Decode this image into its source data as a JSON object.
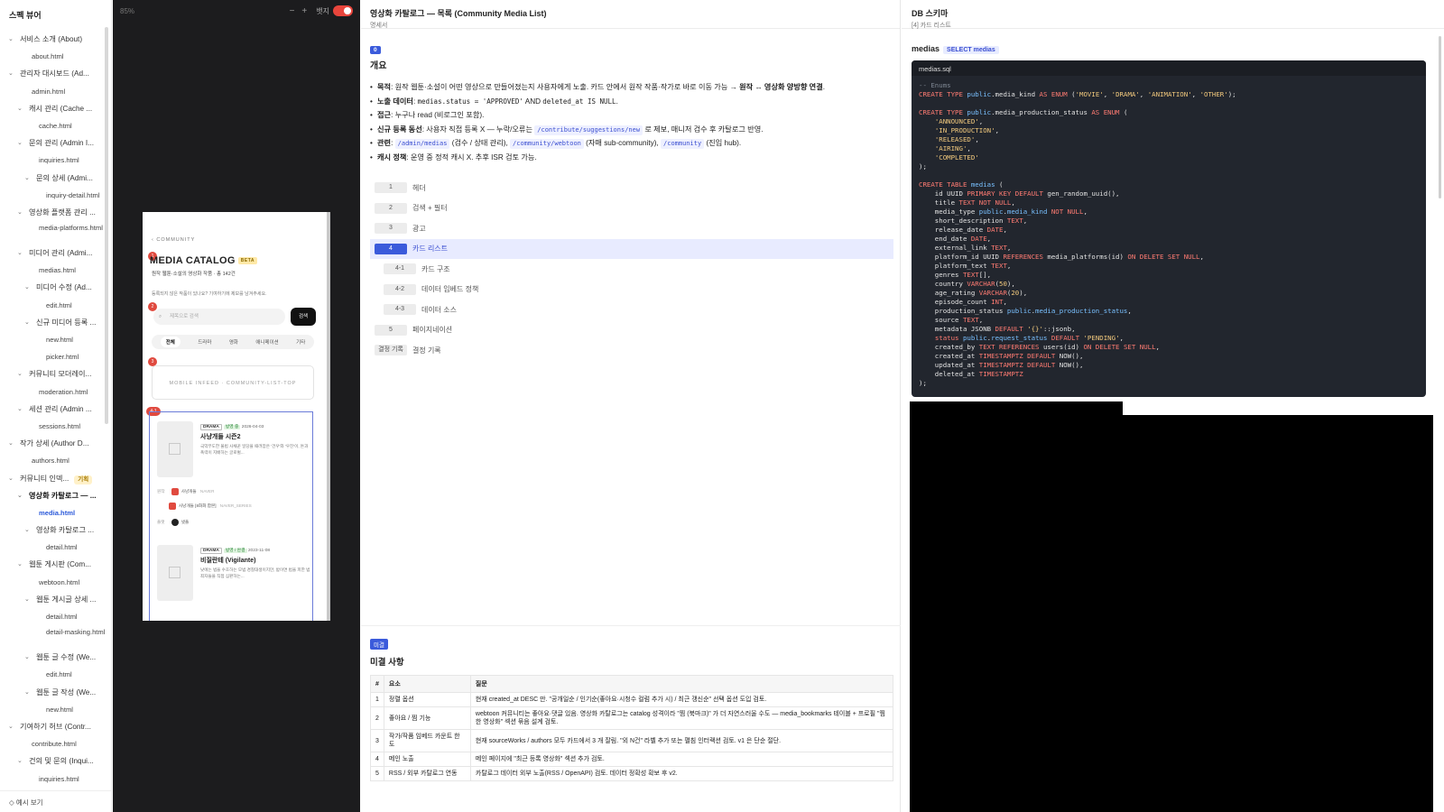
{
  "sidebar": {
    "title": "스펙 뷰어",
    "items": [
      {
        "label": "서비스 소개 (About)",
        "depth": 0,
        "type": "folder"
      },
      {
        "label": "about.html",
        "depth": 1,
        "type": "file"
      },
      {
        "label": "관리자 대시보드 (Ad...",
        "depth": 0,
        "type": "folder"
      },
      {
        "label": "admin.html",
        "depth": 1,
        "type": "file"
      },
      {
        "label": "캐시 관리 (Cache ...",
        "depth": 1,
        "type": "folder"
      },
      {
        "label": "cache.html",
        "depth": 2,
        "type": "file"
      },
      {
        "label": "문의 관리 (Admin I...",
        "depth": 1,
        "type": "folder"
      },
      {
        "label": "inquiries.html",
        "depth": 2,
        "type": "file"
      },
      {
        "label": "문의 상세 (Admi...",
        "depth": 2,
        "type": "folder"
      },
      {
        "label": "inquiry-detail.html",
        "depth": 3,
        "type": "file"
      },
      {
        "label": "영상화 플랫폼 관리 ...",
        "depth": 1,
        "type": "folder"
      },
      {
        "label": "media-platforms.html",
        "depth": 2,
        "type": "file",
        "two": true
      },
      {
        "label": "미디어 관리 (Admi...",
        "depth": 1,
        "type": "folder"
      },
      {
        "label": "medias.html",
        "depth": 2,
        "type": "file"
      },
      {
        "label": "미디어 수정 (Ad...",
        "depth": 2,
        "type": "folder"
      },
      {
        "label": "edit.html",
        "depth": 3,
        "type": "file"
      },
      {
        "label": "신규 미디어 등록 ...",
        "depth": 2,
        "type": "folder"
      },
      {
        "label": "new.html",
        "depth": 3,
        "type": "file"
      },
      {
        "label": "picker.html",
        "depth": 3,
        "type": "file"
      },
      {
        "label": "커뮤니티 모더레이...",
        "depth": 1,
        "type": "folder"
      },
      {
        "label": "moderation.html",
        "depth": 2,
        "type": "file"
      },
      {
        "label": "세션 관리 (Admin ...",
        "depth": 1,
        "type": "folder"
      },
      {
        "label": "sessions.html",
        "depth": 2,
        "type": "file"
      },
      {
        "label": "작가 상세 (Author D...",
        "depth": 0,
        "type": "folder"
      },
      {
        "label": "authors.html",
        "depth": 1,
        "type": "file"
      },
      {
        "label": "커뮤니티 인덱...",
        "depth": 0,
        "type": "folder",
        "badge": "기획"
      },
      {
        "label": "영상화 카탈로그 — ...",
        "depth": 1,
        "type": "folder",
        "bold": true
      },
      {
        "label": "media.html",
        "depth": 2,
        "type": "file",
        "active": true
      },
      {
        "label": "영상화 카탈로그 ...",
        "depth": 2,
        "type": "folder"
      },
      {
        "label": "detail.html",
        "depth": 3,
        "type": "file"
      },
      {
        "label": "웹툰 게시판 (Com...",
        "depth": 1,
        "type": "folder"
      },
      {
        "label": "webtoon.html",
        "depth": 2,
        "type": "file"
      },
      {
        "label": "웹툰 게시글 상세 ...",
        "depth": 2,
        "type": "folder"
      },
      {
        "label": "detail.html",
        "depth": 3,
        "type": "file"
      },
      {
        "label": "detail-masking.html",
        "depth": 3,
        "type": "file",
        "two": true
      },
      {
        "label": "웹툰 글 수정 (We...",
        "depth": 2,
        "type": "folder"
      },
      {
        "label": "edit.html",
        "depth": 3,
        "type": "file"
      },
      {
        "label": "웹툰 글 작성 (We...",
        "depth": 2,
        "type": "folder"
      },
      {
        "label": "new.html",
        "depth": 3,
        "type": "file"
      },
      {
        "label": "기여하기 허브 (Contr...",
        "depth": 0,
        "type": "folder"
      },
      {
        "label": "contribute.html",
        "depth": 1,
        "type": "file"
      },
      {
        "label": "건의 및 문의 (Inqui...",
        "depth": 1,
        "type": "folder"
      },
      {
        "label": "inquiries.html",
        "depth": 2,
        "type": "file"
      }
    ],
    "footer": "예시 보기"
  },
  "preview": {
    "zoom": "85%",
    "minus": "−",
    "plus": "+",
    "toggle_label": "뱃지",
    "phone": {
      "crumb": "‹ COMMUNITY",
      "title": "MEDIA CATALOG",
      "beta": "BETA",
      "sub": "원작 웹툰·소설의 영상화 작품 · 총 142건",
      "sub2": "등록되지 않은 작품이 있나요? 기여하기에 제보를 남겨주세요.",
      "search_placeholder": "제목으로 검색",
      "search_btn": "검색",
      "tabs": [
        "전체",
        "드라마",
        "영화",
        "애니메이션",
        "기타"
      ],
      "ad": "MOBILE INFEED · COMMUNITY-LIST-TOP",
      "pins": [
        "1",
        "2",
        "3",
        "4-1"
      ],
      "cards": [
        {
          "kind": "DRAMA",
          "status": "방영 중",
          "date": "2026-04-03",
          "title": "사냥개들 시즌2",
          "desc": "극악무도한 불법 사채꾼 일당을 때려잡은 '건우'와 '우진'이, 돈과 폭력이 지배하는 글로벌...",
          "row1": "원작",
          "src1": "사냥개들",
          "src1_tag": "NAVER",
          "src2": "사냥개들 [8화화 합본]",
          "src2_tag": "NAVER_SERIES",
          "row2": "플랫",
          "platform": "넷플"
        },
        {
          "kind": "DRAMA",
          "status": "방영 / 완결",
          "date": "2023-11-08",
          "title": "비질란테 (Vigilante)",
          "desc": "낮에는 법을 수호하는 모범 경찰대생이지만, 밤이면 법을 피한 범죄자들을 직접 심판하는..."
        }
      ]
    }
  },
  "doc": {
    "title": "영상화 카탈로그 — 목록 (Community Media List)",
    "subtitle": "명세서",
    "overview_badge": "0",
    "overview_title": "개요",
    "bullets": {
      "b1_label": "목적",
      "b1_text": ": 원작 웹툰·소설이 어떤 영상으로 만들어졌는지 사용자에게 노출. 카드 안에서 원작 작품·작가로 바로 이동 가능 → ",
      "b1_bold": "원작 ↔ 영상화 양방향 연결",
      "b1_end": ".",
      "b2_label": "노출 데이터",
      "b2_code1": "medias.status = 'APPROVED'",
      "b2_mid": " AND ",
      "b2_code2": "deleted_at IS NULL",
      "b2_end": ".",
      "b3_label": "접근",
      "b3_text": ": 누구나 read (비로그인 포함).",
      "b4_label": "신규 등록 동선",
      "b4_text": ": 사용자 직접 등록 X — 누락/오류는 ",
      "b4_link": "/contribute/suggestions/new",
      "b4_end": " 로 제보, 매니저 검수 후 카탈로그 반영.",
      "b5_label": "관련",
      "b5_link1": "/admin/medias",
      "b5_t1": " (검수 / 상태 관리), ",
      "b5_link2": "/community/webtoon",
      "b5_t2": " (자매 sub-community), ",
      "b5_link3": "/community",
      "b5_t3": " (진입 hub).",
      "b6_label": "캐시 정책",
      "b6_text": ": 운영 중 정적 캐시 X. 추후 ISR 검토 가능."
    },
    "toc": [
      {
        "num": "1",
        "label": "헤더",
        "sub": false
      },
      {
        "num": "2",
        "label": "검색 + 필터",
        "sub": false
      },
      {
        "num": "3",
        "label": "광고",
        "sub": false
      },
      {
        "num": "4",
        "label": "카드 리스트",
        "sub": false,
        "active": true
      },
      {
        "num": "4-1",
        "label": "카드 구조",
        "sub": true
      },
      {
        "num": "4-2",
        "label": "데이터 임베드 정책",
        "sub": true
      },
      {
        "num": "4-3",
        "label": "데이터 소스",
        "sub": true
      },
      {
        "num": "5",
        "label": "페이지네이션",
        "sub": false
      },
      {
        "num": "결정 기록",
        "label": "결정 기록",
        "sub": false
      }
    ],
    "unresolved": {
      "badge": "미결",
      "title": "미결 사항",
      "headers": [
        "#",
        "요소",
        "질문"
      ],
      "rows": [
        {
          "n": "1",
          "el": "정렬 옵션",
          "q": "현재 created_at DESC 만. \"공개일순 / 인기순(좋아요·시청수 컬럼 추가 시) / 최근 갱신순\" 선택 옵션 도입 검토."
        },
        {
          "n": "2",
          "el": "좋아요 / 찜 기능",
          "q": "webtoon 커뮤니티는 좋아요·댓글 있음. 영상화 카탈로그는 catalog 성격이라 \"찜 (북마크)\" 가 더 자연스러울 수도 — media_bookmarks 테이블 + 프로필 \"찜한 영상화\" 섹션 묶음 설계 검토."
        },
        {
          "n": "3",
          "el": "작가/작품 임베드 카운트 한도",
          "q": "현재 sourceWorks / authors 모두 카드에서 3 개 잘림. \"외 N건\" 라벨 추가 또는 펼침 인터랙션 검토. v1 은 단순 절단."
        },
        {
          "n": "4",
          "el": "메인 노출",
          "q": "메인 페이지에 \"최근 등록 영상화\" 섹션 추가 검토."
        },
        {
          "n": "5",
          "el": "RSS / 외부 카탈로그 연동",
          "q": "카탈로그 데이터 외부 노출(RSS / OpenAPI) 검토. 데이터 정확성 확보 후 v2."
        }
      ]
    }
  },
  "schema": {
    "title": "DB 스키마",
    "subtitle": "[4] 카드 리스트",
    "table_name": "medias",
    "query_pill": "SELECT medias",
    "file_name": "medias.sql"
  },
  "colors": {
    "accent": "#3b5bdb",
    "active_link": "#2b59d9",
    "pin": "#e04a3f",
    "code_bg": "#22262e"
  }
}
